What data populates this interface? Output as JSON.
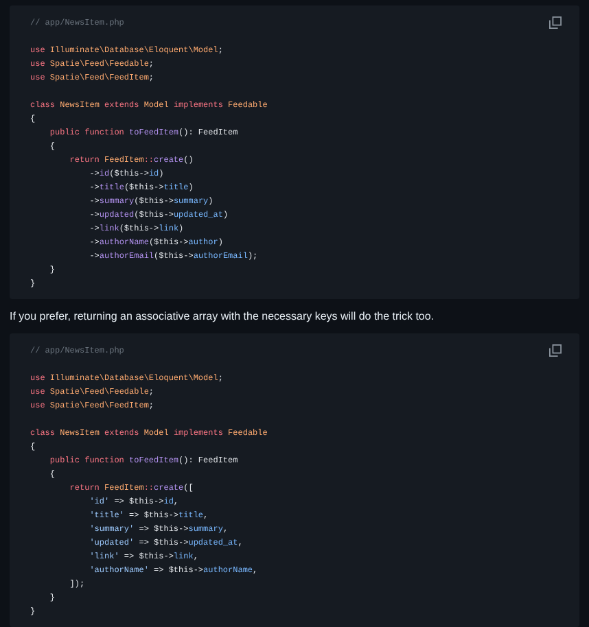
{
  "blocks": [
    {
      "comment": [
        {
          "text": "// app/NewsItem.php",
          "kind": "comment"
        }
      ],
      "imports": [
        [
          {
            "text": "use ",
            "kind": "keyword"
          },
          {
            "text": "Illuminate\\Database\\Eloquent\\Model",
            "kind": "type"
          },
          {
            "text": ";",
            "kind": "plain"
          }
        ],
        [
          {
            "text": "use ",
            "kind": "keyword"
          },
          {
            "text": "Spatie\\Feed\\Feedable",
            "kind": "type"
          },
          {
            "text": ";",
            "kind": "plain"
          }
        ],
        [
          {
            "text": "use ",
            "kind": "keyword"
          },
          {
            "text": "Spatie\\Feed\\FeedItem",
            "kind": "type"
          },
          {
            "text": ";",
            "kind": "plain"
          }
        ]
      ],
      "body": [
        [
          {
            "text": "class ",
            "kind": "keyword"
          },
          {
            "text": "NewsItem ",
            "kind": "type"
          },
          {
            "text": "extends ",
            "kind": "keyword"
          },
          {
            "text": "Model ",
            "kind": "type"
          },
          {
            "text": "implements ",
            "kind": "keyword"
          },
          {
            "text": "Feedable",
            "kind": "type"
          }
        ],
        [
          {
            "text": "{",
            "kind": "plain"
          }
        ],
        [
          {
            "text": "    public function ",
            "kind": "keyword"
          },
          {
            "text": "toFeedItem",
            "kind": "function"
          },
          {
            "text": "(): FeedItem",
            "kind": "plain"
          }
        ],
        [
          {
            "text": "    {",
            "kind": "plain"
          }
        ],
        [
          {
            "text": "        return ",
            "kind": "keyword"
          },
          {
            "text": "FeedItem",
            "kind": "type"
          },
          {
            "text": "::",
            "kind": "keyword"
          },
          {
            "text": "create",
            "kind": "function"
          },
          {
            "text": "()",
            "kind": "plain"
          }
        ],
        [
          {
            "text": "            ->",
            "kind": "plain"
          },
          {
            "text": "id",
            "kind": "function"
          },
          {
            "text": "($this->",
            "kind": "plain"
          },
          {
            "text": "id",
            "kind": "property"
          },
          {
            "text": ")",
            "kind": "plain"
          }
        ],
        [
          {
            "text": "            ->",
            "kind": "plain"
          },
          {
            "text": "title",
            "kind": "function"
          },
          {
            "text": "($this->",
            "kind": "plain"
          },
          {
            "text": "title",
            "kind": "property"
          },
          {
            "text": ")",
            "kind": "plain"
          }
        ],
        [
          {
            "text": "            ->",
            "kind": "plain"
          },
          {
            "text": "summary",
            "kind": "function"
          },
          {
            "text": "($this->",
            "kind": "plain"
          },
          {
            "text": "summary",
            "kind": "property"
          },
          {
            "text": ")",
            "kind": "plain"
          }
        ],
        [
          {
            "text": "            ->",
            "kind": "plain"
          },
          {
            "text": "updated",
            "kind": "function"
          },
          {
            "text": "($this->",
            "kind": "plain"
          },
          {
            "text": "updated_at",
            "kind": "property"
          },
          {
            "text": ")",
            "kind": "plain"
          }
        ],
        [
          {
            "text": "            ->",
            "kind": "plain"
          },
          {
            "text": "link",
            "kind": "function"
          },
          {
            "text": "($this->",
            "kind": "plain"
          },
          {
            "text": "link",
            "kind": "property"
          },
          {
            "text": ")",
            "kind": "plain"
          }
        ],
        [
          {
            "text": "            ->",
            "kind": "plain"
          },
          {
            "text": "authorName",
            "kind": "function"
          },
          {
            "text": "($this->",
            "kind": "plain"
          },
          {
            "text": "author",
            "kind": "property"
          },
          {
            "text": ")",
            "kind": "plain"
          }
        ],
        [
          {
            "text": "            ->",
            "kind": "plain"
          },
          {
            "text": "authorEmail",
            "kind": "function"
          },
          {
            "text": "($this->",
            "kind": "plain"
          },
          {
            "text": "authorEmail",
            "kind": "property"
          },
          {
            "text": ");",
            "kind": "plain"
          }
        ],
        [
          {
            "text": "    }",
            "kind": "plain"
          }
        ],
        [
          {
            "text": "}",
            "kind": "plain"
          }
        ]
      ]
    },
    {
      "comment": [
        {
          "text": "// app/NewsItem.php",
          "kind": "comment"
        }
      ],
      "imports": [
        [
          {
            "text": "use ",
            "kind": "keyword"
          },
          {
            "text": "Illuminate\\Database\\Eloquent\\Model",
            "kind": "type"
          },
          {
            "text": ";",
            "kind": "plain"
          }
        ],
        [
          {
            "text": "use ",
            "kind": "keyword"
          },
          {
            "text": "Spatie\\Feed\\Feedable",
            "kind": "type"
          },
          {
            "text": ";",
            "kind": "plain"
          }
        ],
        [
          {
            "text": "use ",
            "kind": "keyword"
          },
          {
            "text": "Spatie\\Feed\\FeedItem",
            "kind": "type"
          },
          {
            "text": ";",
            "kind": "plain"
          }
        ]
      ],
      "body": [
        [
          {
            "text": "class ",
            "kind": "keyword"
          },
          {
            "text": "NewsItem ",
            "kind": "type"
          },
          {
            "text": "extends ",
            "kind": "keyword"
          },
          {
            "text": "Model ",
            "kind": "type"
          },
          {
            "text": "implements ",
            "kind": "keyword"
          },
          {
            "text": "Feedable",
            "kind": "type"
          }
        ],
        [
          {
            "text": "{",
            "kind": "plain"
          }
        ],
        [
          {
            "text": "    public function ",
            "kind": "keyword"
          },
          {
            "text": "toFeedItem",
            "kind": "function"
          },
          {
            "text": "(): FeedItem",
            "kind": "plain"
          }
        ],
        [
          {
            "text": "    {",
            "kind": "plain"
          }
        ],
        [
          {
            "text": "        return ",
            "kind": "keyword"
          },
          {
            "text": "FeedItem",
            "kind": "type"
          },
          {
            "text": "::",
            "kind": "keyword"
          },
          {
            "text": "create",
            "kind": "function"
          },
          {
            "text": "([",
            "kind": "plain"
          }
        ],
        [
          {
            "text": "            'id'",
            "kind": "string"
          },
          {
            "text": " => $this->",
            "kind": "plain"
          },
          {
            "text": "id",
            "kind": "property"
          },
          {
            "text": ",",
            "kind": "plain"
          }
        ],
        [
          {
            "text": "            'title'",
            "kind": "string"
          },
          {
            "text": " => $this->",
            "kind": "plain"
          },
          {
            "text": "title",
            "kind": "property"
          },
          {
            "text": ",",
            "kind": "plain"
          }
        ],
        [
          {
            "text": "            'summary'",
            "kind": "string"
          },
          {
            "text": " => $this->",
            "kind": "plain"
          },
          {
            "text": "summary",
            "kind": "property"
          },
          {
            "text": ",",
            "kind": "plain"
          }
        ],
        [
          {
            "text": "            'updated'",
            "kind": "string"
          },
          {
            "text": " => $this->",
            "kind": "plain"
          },
          {
            "text": "updated_at",
            "kind": "property"
          },
          {
            "text": ",",
            "kind": "plain"
          }
        ],
        [
          {
            "text": "            'link'",
            "kind": "string"
          },
          {
            "text": " => $this->",
            "kind": "plain"
          },
          {
            "text": "link",
            "kind": "property"
          },
          {
            "text": ",",
            "kind": "plain"
          }
        ],
        [
          {
            "text": "            'authorName'",
            "kind": "string"
          },
          {
            "text": " => $this->",
            "kind": "plain"
          },
          {
            "text": "authorName",
            "kind": "property"
          },
          {
            "text": ",",
            "kind": "plain"
          }
        ],
        [
          {
            "text": "        ]);",
            "kind": "plain"
          }
        ],
        [
          {
            "text": "    }",
            "kind": "plain"
          }
        ],
        [
          {
            "text": "}",
            "kind": "plain"
          }
        ]
      ]
    }
  ],
  "paragraph": "If you prefer, returning an associative array with the necessary keys will do the trick too."
}
